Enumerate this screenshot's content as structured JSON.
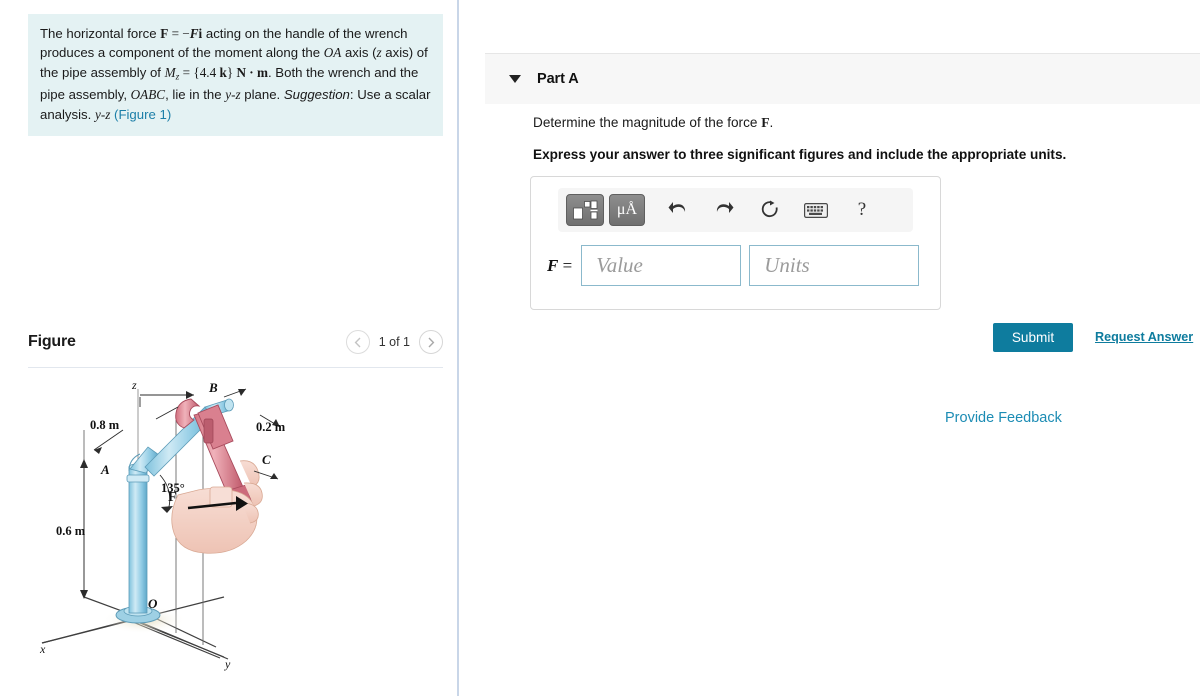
{
  "problem": {
    "line1_a": "The horizontal force ",
    "F_bold": "F",
    "eq": " = ",
    "minus": "−",
    "F_ital": "F",
    "i_bold": "i",
    "line1_b": " acting on the handle of the wrench produces a component of the moment along the ",
    "OA": "OA",
    "line2_b": " axis (",
    "z": "z",
    "line2_c": " axis) of the pipe assembly of ",
    "M": "M",
    "M_sub": "z",
    "M_eq": " = ",
    "brace_open": "{",
    "val": "4.4 ",
    "k_bold": "k",
    "brace_close": "}",
    "units": " N · m",
    "line3_b": ". Both the wrench and the pipe assembly, ",
    "OABC": "OABC",
    "line4_b": ", lie in the ",
    "yz1": "y-z",
    "line4_c": " plane. ",
    "suggestion": "Suggestion",
    "colon": ": Use a scalar analysis. ",
    "yz2": "y-z",
    "space": " ",
    "figure_link": "(Figure 1)"
  },
  "figure_panel": {
    "title": "Figure",
    "pager_label": "1 of 1",
    "prev_icon": "chevron-left-icon",
    "next_icon": "chevron-right-icon"
  },
  "figure_diagram": {
    "axis_z": "z",
    "axis_x": "x",
    "axis_y": "y",
    "point_O": "O",
    "point_A": "A",
    "point_B": "B",
    "point_C": "C",
    "dim_08": "0.8 m",
    "dim_02": "0.2 m",
    "dim_06": "0.6 m",
    "angle": "135°",
    "force_label": "F",
    "colors": {
      "pipe": "#9fd3e8",
      "pipe_dark": "#69b3d4",
      "wrench": "#e08a96",
      "wrench_dark": "#c1606f",
      "hand": "#f4cfc4",
      "line": "#3a3a3a"
    }
  },
  "part_a": {
    "caret_icon": "caret-down-icon",
    "title": "Part A",
    "question_a": "Determine the magnitude of the force ",
    "question_F": "F",
    "question_b": ".",
    "instruction": "Express your answer to three significant figures and include the appropriate units."
  },
  "answer_widget": {
    "toolbar": [
      {
        "name": "template-icon",
        "label": ""
      },
      {
        "name": "units-icon",
        "label": "μÅ"
      },
      {
        "name": "undo-icon",
        "label": ""
      },
      {
        "name": "redo-icon",
        "label": ""
      },
      {
        "name": "reset-icon",
        "label": ""
      },
      {
        "name": "keyboard-icon",
        "label": ""
      },
      {
        "name": "help-icon",
        "label": "?"
      }
    ],
    "field_label": "F",
    "field_eq": " =",
    "value_placeholder": "Value",
    "units_placeholder": "Units",
    "value_current": "",
    "units_current": ""
  },
  "actions": {
    "submit_label": "Submit",
    "request_answer_label": "Request Answer",
    "provide_feedback_label": "Provide Feedback"
  },
  "theme": {
    "accent": "#0e7c9e",
    "link": "#1c8cb4",
    "problem_bg": "#e4f2f3",
    "band_bg": "#f7f7f7"
  }
}
